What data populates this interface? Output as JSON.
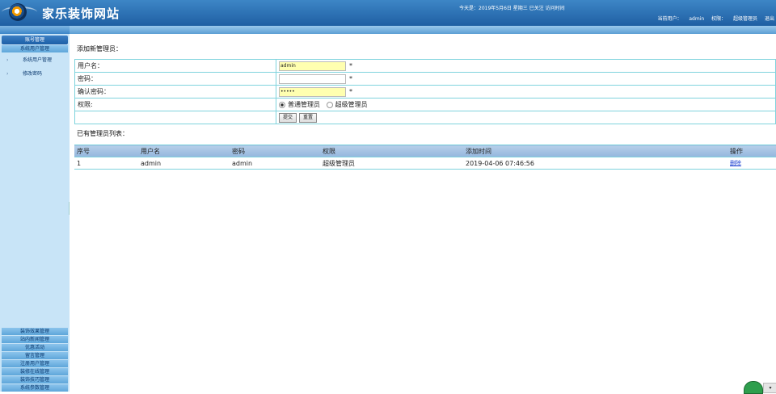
{
  "header": {
    "site_title": "家乐装饰网站",
    "date_text": "今天是：2019年5月6日 星期三 已关注 访问时间",
    "user_links": [
      "当前用户：",
      "admin",
      "权限：",
      "超级管理员",
      "退出"
    ]
  },
  "sidebar": {
    "head": "账号管理",
    "sub": "系统用户管理",
    "items": [
      "系统用户管理",
      "修改密码"
    ],
    "bottom": [
      "装饰效果管理",
      "站内新闻管理",
      "优惠活动",
      "留言管理",
      "注册用户管理",
      "装修在线管理",
      "装饰技巧管理",
      "系统参数管理"
    ]
  },
  "add_form": {
    "title": "添加新管理员：",
    "username_label": "用户名：",
    "username_value": "admin",
    "password_label": "密码：",
    "password_value": "",
    "confirm_label": "确认密码：",
    "confirm_value": "•••••",
    "required_mark": "*",
    "role_label": "权限:",
    "role_options": [
      "普通管理员",
      "超级管理员"
    ],
    "submit_label": "提交",
    "reset_label": "重置"
  },
  "list": {
    "title": "已有管理员列表：",
    "headers": [
      "序号",
      "用户名",
      "密码",
      "权限",
      "添加时间",
      "操作"
    ],
    "rows": [
      {
        "id": "1",
        "username": "admin",
        "password": "admin",
        "role": "超级管理员",
        "added": "2019-04-06 07:46:56",
        "action": "删除"
      }
    ]
  },
  "colors": {
    "header": "#1f5fa3",
    "sidebar": "#c8e4f7",
    "border": "#7fd3dd",
    "highlight_input": "#ffffb0"
  }
}
